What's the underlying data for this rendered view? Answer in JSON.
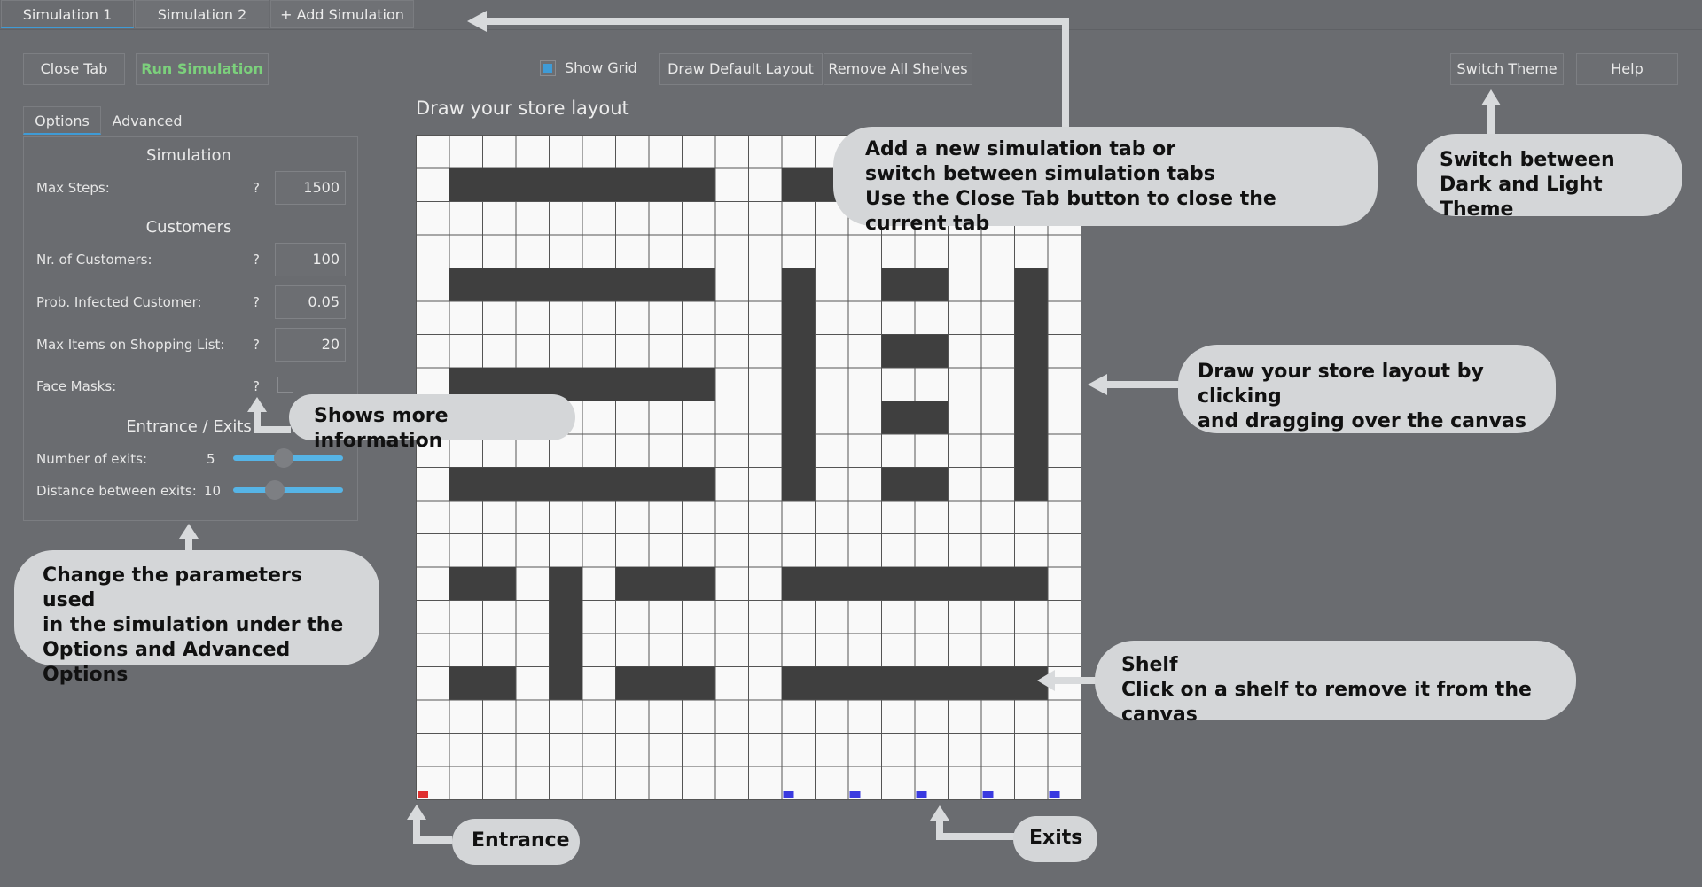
{
  "tabs": [
    {
      "label": "Simulation 1",
      "active": true
    },
    {
      "label": "Simulation 2",
      "active": false
    },
    {
      "label": "+ Add Simulation",
      "active": false
    }
  ],
  "toolbar": {
    "close_tab": "Close Tab",
    "run_simulation": "Run Simulation",
    "show_grid_label": "Show Grid",
    "show_grid_checked": true,
    "draw_default_layout": "Draw Default Layout",
    "remove_all_shelves": "Remove All Shelves",
    "switch_theme": "Switch Theme",
    "help": "Help"
  },
  "options_tabs": [
    {
      "label": "Options",
      "active": true
    },
    {
      "label": "Advanced",
      "active": false
    }
  ],
  "options": {
    "simulation_header": "Simulation",
    "max_steps_label": "Max Steps:",
    "max_steps_value": "1500",
    "customers_header": "Customers",
    "nr_customers_label": "Nr. of Customers:",
    "nr_customers_value": "100",
    "prob_infected_label": "Prob. Infected Customer:",
    "prob_infected_value": "0.05",
    "max_items_label": "Max Items on Shopping List:",
    "max_items_value": "20",
    "face_masks_label": "Face Masks:",
    "face_masks_checked": false,
    "help_mark": "?",
    "entrance_header": "Entrance / Exits",
    "num_exits_label": "Number of exits:",
    "num_exits_value": "5",
    "num_exits_fraction": 0.45,
    "distance_label": "Distance between exits:",
    "distance_value": "10",
    "distance_fraction": 0.35
  },
  "canvas": {
    "title": "Draw your store layout",
    "cols": 20,
    "rows": 20,
    "shelves": [
      {
        "row": 1,
        "col_start": 1,
        "col_end": 8
      },
      {
        "row": 1,
        "col_start": 11,
        "col_end": 13
      },
      {
        "row": 4,
        "col_start": 1,
        "col_end": 8
      },
      {
        "row": 7,
        "col_start": 1,
        "col_end": 8
      },
      {
        "row": 10,
        "col_start": 1,
        "col_end": 8
      },
      {
        "col": 11,
        "row_start": 4,
        "row_end": 10
      },
      {
        "col": 18,
        "row_start": 4,
        "row_end": 10
      },
      {
        "row": 4,
        "col_start": 14,
        "col_end": 15
      },
      {
        "row": 6,
        "col_start": 14,
        "col_end": 15
      },
      {
        "row": 8,
        "col_start": 14,
        "col_end": 15
      },
      {
        "row": 10,
        "col_start": 14,
        "col_end": 15
      },
      {
        "row": 13,
        "col_start": 1,
        "col_end": 2
      },
      {
        "row": 13,
        "col_start": 6,
        "col_end": 8
      },
      {
        "row": 13,
        "col_start": 11,
        "col_end": 18
      },
      {
        "col": 4,
        "row_start": 13,
        "row_end": 16
      },
      {
        "row": 16,
        "col_start": 1,
        "col_end": 2
      },
      {
        "row": 16,
        "col_start": 6,
        "col_end": 8
      },
      {
        "row": 16,
        "col_start": 11,
        "col_end": 18
      }
    ],
    "entrance_col": 0,
    "exit_cols": [
      11,
      13,
      15,
      17,
      19
    ],
    "entrance_color": "#e03030",
    "exit_color": "#3a3ae0"
  },
  "callouts": {
    "tabs": [
      "Add a new simulation tab or",
      "switch between simulation tabs",
      "Use the Close Tab button to close the current tab"
    ],
    "theme": [
      "Switch between",
      "Dark and Light Theme"
    ],
    "info": "Shows more information",
    "draw": [
      "Draw your store layout by clicking",
      "and dragging over the canvas"
    ],
    "params": [
      "Change the parameters used",
      "in the simulation under the",
      "Options and Advanced Options"
    ],
    "shelf": [
      "Shelf",
      "Click on a shelf to remove it from the canvas"
    ],
    "entrance": "Entrance",
    "exits": "Exits"
  },
  "colors": {
    "background": "#6a6c70",
    "accent": "#3f9bd6",
    "run_green": "#7cd07c",
    "shelf": "#3f3f3f",
    "cell": "#f9f9f9",
    "callout_bg": "#d4d6d8"
  }
}
